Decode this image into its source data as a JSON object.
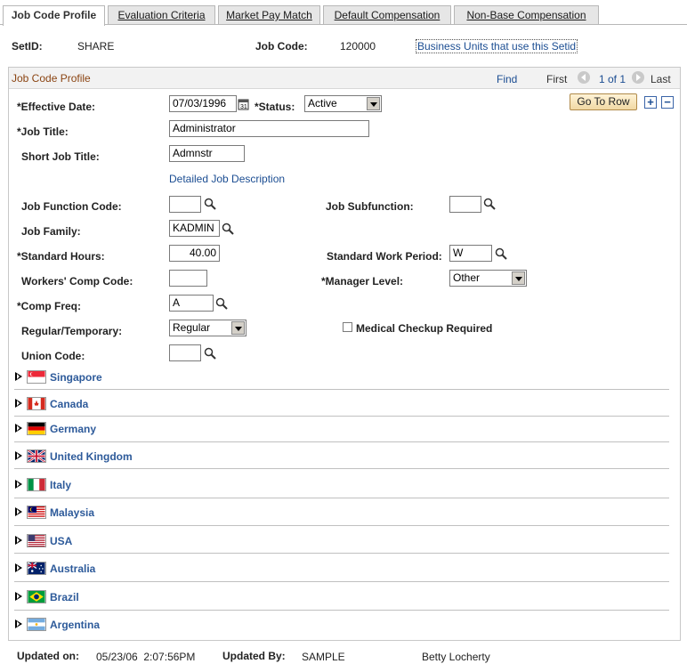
{
  "tabs": [
    {
      "label": "Job Code Profile",
      "active": true
    },
    {
      "label": "Evaluation Criteria",
      "active": false
    },
    {
      "label": "Market Pay Match",
      "active": false
    },
    {
      "label": "Default Compensation",
      "active": false
    },
    {
      "label": "Non-Base Compensation",
      "active": false
    }
  ],
  "header": {
    "setid_label": "SetID:",
    "setid_value": "SHARE",
    "jobcode_label": "Job Code:",
    "jobcode_value": "120000",
    "bu_link": "Business Units that use this Setid"
  },
  "panel": {
    "title": "Job Code Profile",
    "find": "Find",
    "first": "First",
    "page": "1 of 1",
    "last": "Last",
    "goto_row": "Go To Row",
    "plus": "+",
    "minus": "−"
  },
  "form": {
    "effective_date_label": "*Effective Date:",
    "effective_date_value": "07/03/1996",
    "status_label": "*Status:",
    "status_value": "Active",
    "job_title_label": "*Job Title:",
    "job_title_value": "Administrator",
    "short_title_label": "Short Job Title:",
    "short_title_value": "Admnstr",
    "detailed_desc_link": "Detailed Job Description",
    "job_function_label": "Job Function Code:",
    "job_function_value": "",
    "job_subfunction_label": "Job Subfunction:",
    "job_subfunction_value": "",
    "job_family_label": "Job Family:",
    "job_family_value": "KADMIN",
    "std_hours_label": "*Standard Hours:",
    "std_hours_value": "40.00",
    "std_work_period_label": "Standard Work Period:",
    "std_work_period_value": "W",
    "workers_comp_label": "Workers' Comp Code:",
    "workers_comp_value": "",
    "manager_level_label": "*Manager Level:",
    "manager_level_value": "Other",
    "comp_freq_label": "*Comp Freq:",
    "comp_freq_value": "A",
    "reg_temp_label": "Regular/Temporary:",
    "reg_temp_value": "Regular",
    "medical_label": "Medical Checkup Required",
    "union_label": "Union Code:",
    "union_value": ""
  },
  "countries": [
    "Singapore",
    "Canada",
    "Germany",
    "United Kingdom",
    "Italy",
    "Malaysia",
    "USA",
    "Australia",
    "Brazil",
    "Argentina"
  ],
  "footer": {
    "updated_on_label": "Updated on:",
    "updated_on_value": "05/23/06  2:07:56PM",
    "updated_by_label": "Updated By:",
    "updated_by_value": "SAMPLE",
    "updated_by_name": "Betty Locherty"
  },
  "colors": {
    "link": "#1b4d92",
    "country_link": "#2d5a9a",
    "panel_title": "#8b4513"
  }
}
